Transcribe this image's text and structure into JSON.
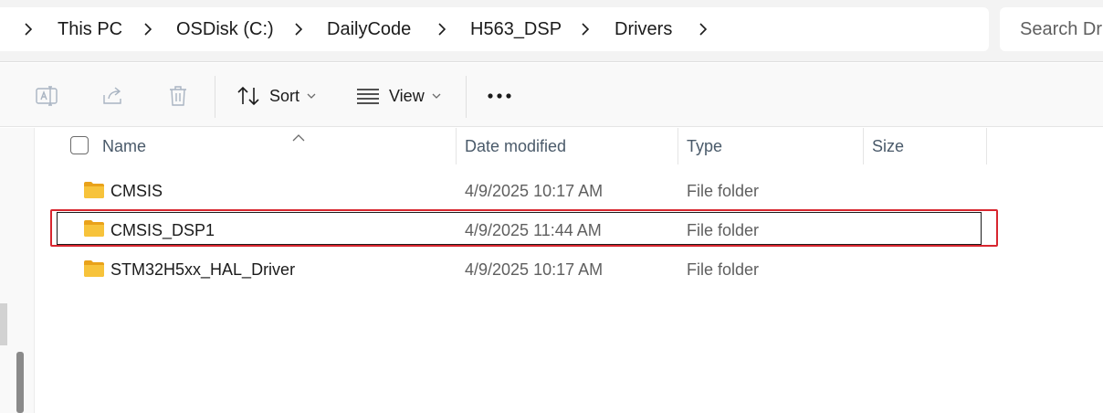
{
  "breadcrumb": {
    "items": [
      "This PC",
      "OSDisk (C:)",
      "DailyCode",
      "H563_DSP",
      "Drivers"
    ]
  },
  "search": {
    "placeholder": "Search Dr"
  },
  "toolbar": {
    "sort_label": "Sort",
    "view_label": "View",
    "rename_icon": "rename-icon",
    "share_icon": "share-icon",
    "delete_icon": "trash-icon",
    "more_icon": "more-icon"
  },
  "columns": {
    "name": "Name",
    "date_modified": "Date modified",
    "type": "Type",
    "size": "Size"
  },
  "files": [
    {
      "name": "CMSIS",
      "date": "4/9/2025 10:17 AM",
      "type": "File folder",
      "size": ""
    },
    {
      "name": "CMSIS_DSP1",
      "date": "4/9/2025 11:44 AM",
      "type": "File folder",
      "size": ""
    },
    {
      "name": "STM32H5xx_HAL_Driver",
      "date": "4/9/2025 10:17 AM",
      "type": "File folder",
      "size": ""
    }
  ],
  "selected_row": 1,
  "colors": {
    "highlight": "#d8262f",
    "folder": "#f7c33b"
  }
}
